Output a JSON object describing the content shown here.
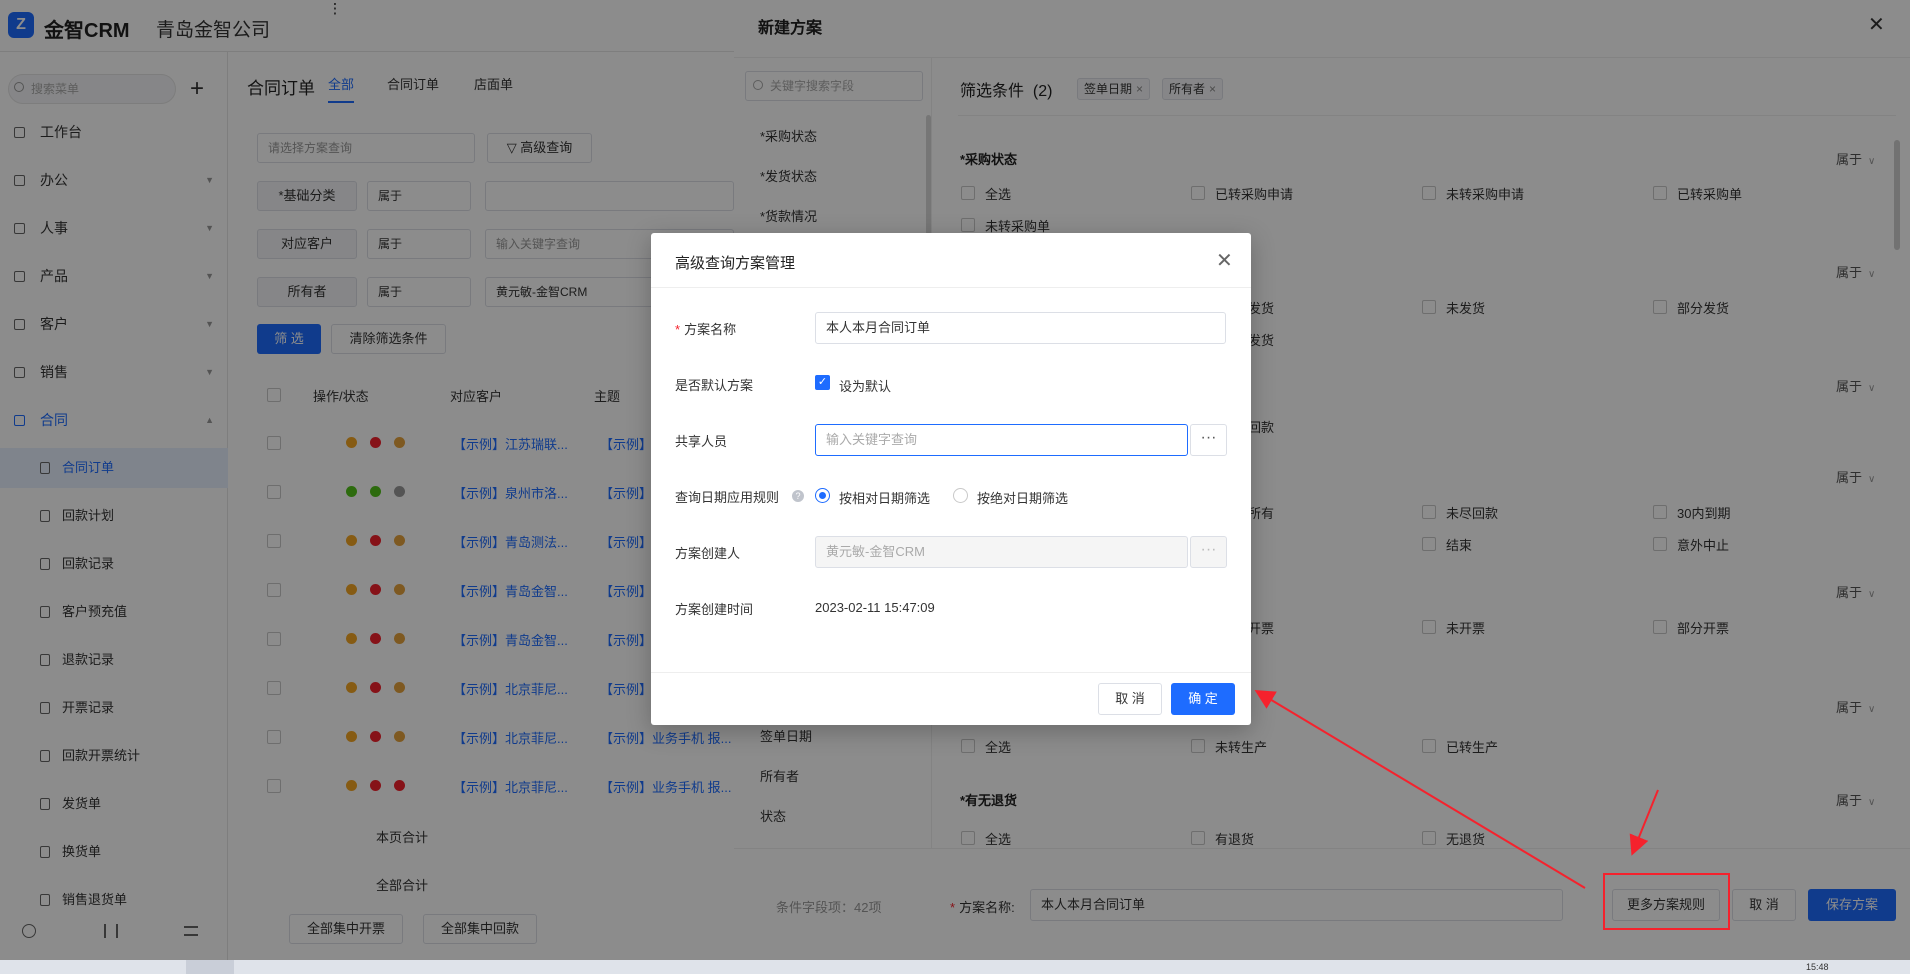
{
  "app": {
    "logo_text": "金智CRM",
    "company": "青岛金智公司",
    "logo_glyph": "Z"
  },
  "sidebar": {
    "search_placeholder": "搜索菜单",
    "add": "+",
    "items": [
      {
        "label": "工作台"
      },
      {
        "label": "办公"
      },
      {
        "label": "人事"
      },
      {
        "label": "产品"
      },
      {
        "label": "客户"
      },
      {
        "label": "销售"
      },
      {
        "label": "合同"
      }
    ],
    "sub_items": [
      {
        "label": "合同订单"
      },
      {
        "label": "回款计划"
      },
      {
        "label": "回款记录"
      },
      {
        "label": "客户预充值"
      },
      {
        "label": "退款记录"
      },
      {
        "label": "开票记录"
      },
      {
        "label": "回款开票统计"
      },
      {
        "label": "发货单"
      },
      {
        "label": "换货单"
      },
      {
        "label": "销售退货单"
      }
    ]
  },
  "content": {
    "title": "合同订单",
    "tabs": [
      "全部",
      "合同订单",
      "店面单"
    ],
    "scheme_select_placeholder": "请选择方案查询",
    "adv_query": "高级查询",
    "filters": [
      {
        "label": "*基础分类",
        "op": "属于",
        "value": ""
      },
      {
        "label": "对应客户",
        "op": "属于",
        "value": "输入关键字查询"
      },
      {
        "label": "所有者",
        "op": "属于",
        "value": "黄元敏-金智CRM"
      }
    ],
    "btn_filter": "筛 选",
    "btn_clear": "清除筛选条件",
    "headers": [
      "操作/状态",
      "对应客户",
      "主题"
    ],
    "rows": [
      {
        "customer": "【示例】江苏瑞联...",
        "subject": "【示例】"
      },
      {
        "customer": "【示例】泉州市洛...",
        "subject": "【示例】"
      },
      {
        "customer": "【示例】青岛测法...",
        "subject": "【示例】"
      },
      {
        "customer": "【示例】青岛金智...",
        "subject": "【示例】"
      },
      {
        "customer": "【示例】青岛金智...",
        "subject": "【示例】"
      },
      {
        "customer": "【示例】北京菲尼...",
        "subject": "【示例】"
      },
      {
        "customer": "【示例】北京菲尼...",
        "subject": "【示例】业务手机 报..."
      },
      {
        "customer": "【示例】北京菲尼...",
        "subject": "【示例】业务手机 报..."
      }
    ],
    "page_total": "本页合计",
    "all_total": "全部合计",
    "btn_invoice": "全部集中开票",
    "btn_payment": "全部集中回款"
  },
  "drawer": {
    "title": "新建方案",
    "field_search_placeholder": "关键字搜索字段",
    "fields_top": [
      "*采购状态",
      "*发货状态",
      "*货款情况"
    ],
    "fields_bottom": [
      "签单日期",
      "所有者",
      "状态"
    ],
    "cond_title": "筛选条件",
    "cond_count": "(2)",
    "tags": [
      "签单日期",
      "所有者"
    ],
    "belong": "属于",
    "sections": [
      {
        "title": "*采购状态",
        "options": [
          "全选",
          "已转采购申请",
          "未转采购申请",
          "已转采购单",
          "未转采购单"
        ]
      },
      {
        "options_partial": [
          "发货",
          "未发货",
          "部分发货",
          "发货"
        ]
      },
      {
        "options_partial": [
          "回款"
        ]
      },
      {
        "options_partial": [
          "所有",
          "未尽回款",
          "30内到期",
          "结束",
          "意外中止"
        ]
      },
      {
        "options_partial": [
          "开票",
          "未开票",
          "部分开票"
        ]
      },
      {
        "options": [
          "全选",
          "未转生产",
          "已转生产"
        ]
      },
      {
        "title": "*有无退货",
        "options": [
          "全选",
          "有退货",
          "无退货"
        ]
      }
    ],
    "footer": {
      "field_count": "条件字段项：42项",
      "name_label": "方案名称:",
      "name_value": "本人本月合同订单",
      "btn_more": "更多方案规则",
      "btn_cancel": "取 消",
      "btn_save": "保存方案"
    }
  },
  "dialog": {
    "title": "高级查询方案管理",
    "name_label": "方案名称",
    "name_value": "本人本月合同订单",
    "default_label": "是否默认方案",
    "default_check": "设为默认",
    "share_label": "共享人员",
    "share_placeholder": "输入关键字查询",
    "date_rule_label": "查询日期应用规则",
    "radio_relative": "按相对日期筛选",
    "radio_absolute": "按绝对日期筛选",
    "creator_label": "方案创建人",
    "creator_value": "黄元敏-金智CRM",
    "created_label": "方案创建时间",
    "created_value": "2023-02-11 15:47:09",
    "btn_cancel": "取 消",
    "btn_ok": "确 定"
  },
  "taskbar": {
    "time": "15:48"
  },
  "colors": {
    "primary": "#1e6cff",
    "annotation": "#f5222d"
  }
}
